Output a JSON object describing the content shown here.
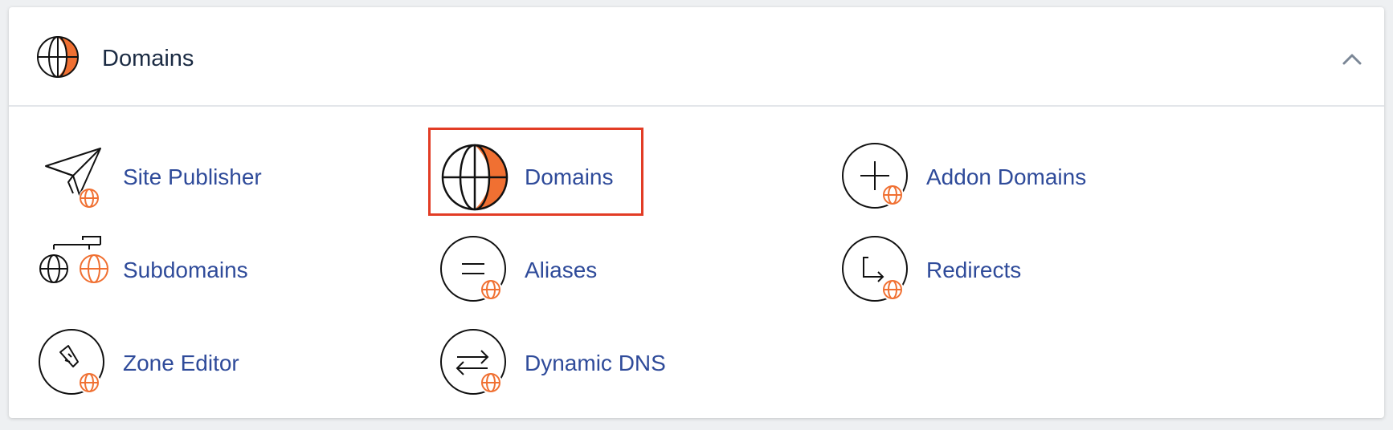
{
  "panel": {
    "title": "Domains",
    "header_icon": "globe-icon",
    "collapse_icon": "chevron-up-icon"
  },
  "tools": [
    {
      "label": "Site Publisher",
      "icon": "paper-plane-globe-icon"
    },
    {
      "label": "Domains",
      "icon": "globe-icon",
      "highlighted": true
    },
    {
      "label": "Addon Domains",
      "icon": "plus-circle-globe-icon"
    },
    {
      "label": "Subdomains",
      "icon": "subdomain-tree-globe-icon"
    },
    {
      "label": "Aliases",
      "icon": "equals-circle-globe-icon"
    },
    {
      "label": "Redirects",
      "icon": "redirect-arrow-globe-icon"
    },
    {
      "label": "Zone Editor",
      "icon": "pen-circle-globe-icon"
    },
    {
      "label": "Dynamic DNS",
      "icon": "swap-arrows-globe-icon"
    }
  ],
  "colors": {
    "accent": "#f07032",
    "link": "#2f4b9a",
    "highlight_border": "#e23c25",
    "title": "#1b2b43"
  }
}
